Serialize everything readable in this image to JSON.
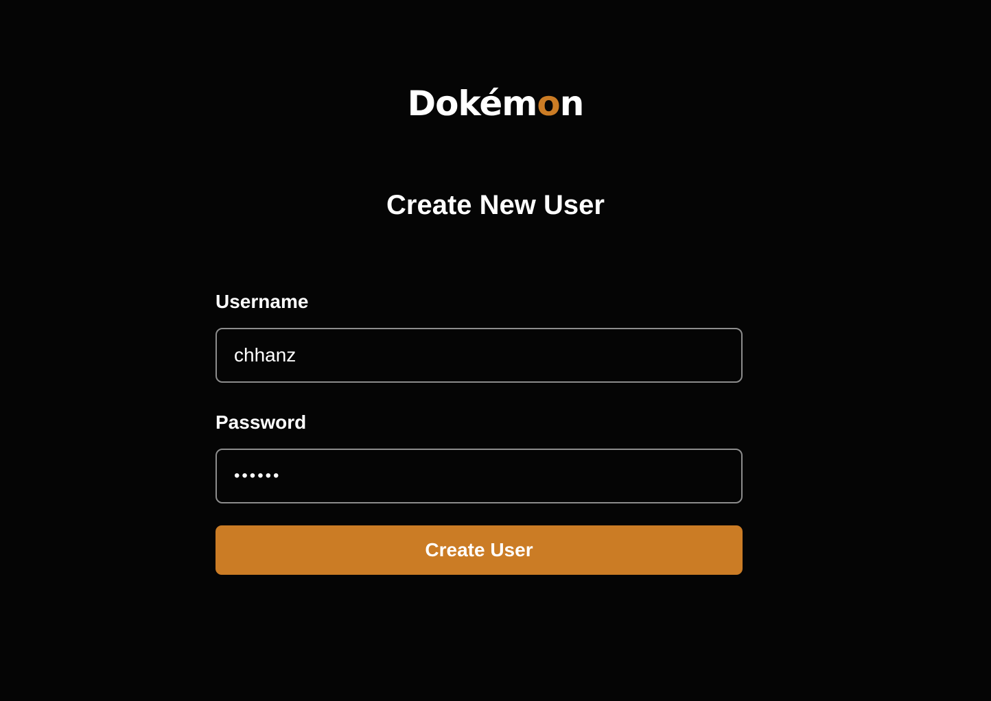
{
  "brand": {
    "name_prefix": "Dokém",
    "name_accent": "o",
    "name_suffix": "n",
    "accent_color": "#cb7c25"
  },
  "page": {
    "title": "Create New User"
  },
  "form": {
    "username": {
      "label": "Username",
      "value": "chhanz"
    },
    "password": {
      "label": "Password",
      "value": "••••••"
    },
    "submit_label": "Create User"
  },
  "colors": {
    "background": "#050505",
    "accent": "#cb7c25",
    "field_border": "#8d8d8d"
  }
}
